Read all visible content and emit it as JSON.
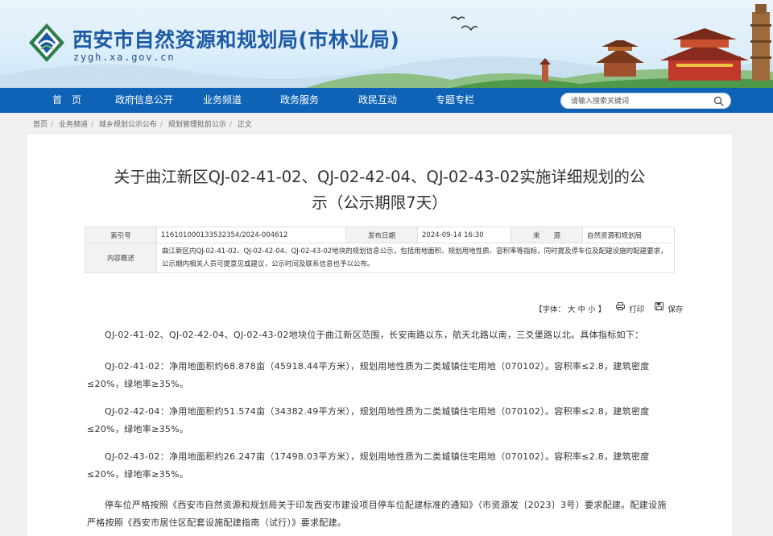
{
  "header": {
    "site_title": "西安市自然资源和规划局(市林业局)",
    "domain": "zygh.xa.gov.cn",
    "logo": "government-emblem-logo",
    "nav": [
      "首　页",
      "政府信息公开",
      "业务频道",
      "政务服务",
      "政民互动",
      "专题专栏"
    ],
    "search": {
      "placeholder": "请输入搜索关键词",
      "icon": "search-icon"
    },
    "nav_color": "#0f63b7"
  },
  "breadcrumb": [
    "首页",
    "业务频道",
    "城乡规划公示公布",
    "规划管理批前公示",
    "正文"
  ],
  "article": {
    "title_line1": "关于曲江新区QJ-02-41-02、QJ-02-42-04、QJ-02-43-02实施详细规划的公",
    "title_line2": "示（公示期限7天）",
    "meta": {
      "index_label": "索引号",
      "index_value": "11610100013353235​4/2024-004612",
      "date_label": "发布日期",
      "date_value": "2024-09-14 16:30",
      "source_label": "来　　源",
      "source_value": "自然资源和规划局",
      "summary_label": "内容概述",
      "summary_value": "曲江新区内QJ-02-41-02、QJ-02-42-04、QJ-02-43-02地块的规划信息公示，包括用地面积、规划用地性质、容积率等指标，同时提及停车位及配建设施的配建要求，公示期内相关人员可提意见或建议，公示时间及联系信息也予以公布。"
    },
    "tools": {
      "font_label": "【字体：",
      "font_large": "大",
      "font_medium": "中",
      "font_small": "小",
      "font_end": "】",
      "print": "打印",
      "save": "保存"
    },
    "paragraphs": [
      "QJ-02-41-02、QJ-02-42-04、QJ-02-43-02地块位于曲江新区范围，长安南路以东，航天北路以南，三爻堡路以北。具体指标如下：",
      "QJ-02-41-02：净用地面积约68.878亩（45918.44平方米），规划用地性质为二类城镇住宅用地（070102）。容积率≤2.8，建筑密度≤20%，绿地率≥35%。",
      "QJ-02-42-04：净用地面积约51.574亩（34382.49平方米），规划用地性质为二类城镇住宅用地（070102）。容积率≤2.8，建筑密度≤20%，绿地率≥35%。",
      "QJ-02-43-02：净用地面积约26.247亩（17498.03平方米），规划用地性质为二类城镇住宅用地（070102）。容积率≤2.8，建筑密度≤20%，绿地率≥35%。",
      "停车位严格按照《西安市自然资源和规划局关于印发西安市建设项目停车位配建标准的通知》（市资源发〔2023〕3号）要求配建。配建设施严格按照《西安市居住区配套设施配建指南（试行）》要求配建。"
    ]
  }
}
